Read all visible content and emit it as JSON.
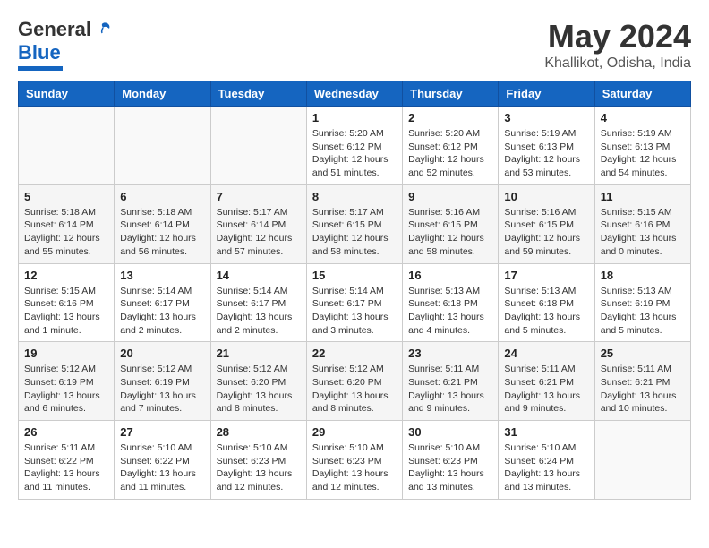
{
  "header": {
    "logo_general": "General",
    "logo_blue": "Blue",
    "month": "May 2024",
    "location": "Khallikot, Odisha, India"
  },
  "weekdays": [
    "Sunday",
    "Monday",
    "Tuesday",
    "Wednesday",
    "Thursday",
    "Friday",
    "Saturday"
  ],
  "weeks": [
    [
      {
        "day": "",
        "sunrise": "",
        "sunset": "",
        "daylight": ""
      },
      {
        "day": "",
        "sunrise": "",
        "sunset": "",
        "daylight": ""
      },
      {
        "day": "",
        "sunrise": "",
        "sunset": "",
        "daylight": ""
      },
      {
        "day": "1",
        "sunrise": "Sunrise: 5:20 AM",
        "sunset": "Sunset: 6:12 PM",
        "daylight": "Daylight: 12 hours and 51 minutes."
      },
      {
        "day": "2",
        "sunrise": "Sunrise: 5:20 AM",
        "sunset": "Sunset: 6:12 PM",
        "daylight": "Daylight: 12 hours and 52 minutes."
      },
      {
        "day": "3",
        "sunrise": "Sunrise: 5:19 AM",
        "sunset": "Sunset: 6:13 PM",
        "daylight": "Daylight: 12 hours and 53 minutes."
      },
      {
        "day": "4",
        "sunrise": "Sunrise: 5:19 AM",
        "sunset": "Sunset: 6:13 PM",
        "daylight": "Daylight: 12 hours and 54 minutes."
      }
    ],
    [
      {
        "day": "5",
        "sunrise": "Sunrise: 5:18 AM",
        "sunset": "Sunset: 6:14 PM",
        "daylight": "Daylight: 12 hours and 55 minutes."
      },
      {
        "day": "6",
        "sunrise": "Sunrise: 5:18 AM",
        "sunset": "Sunset: 6:14 PM",
        "daylight": "Daylight: 12 hours and 56 minutes."
      },
      {
        "day": "7",
        "sunrise": "Sunrise: 5:17 AM",
        "sunset": "Sunset: 6:14 PM",
        "daylight": "Daylight: 12 hours and 57 minutes."
      },
      {
        "day": "8",
        "sunrise": "Sunrise: 5:17 AM",
        "sunset": "Sunset: 6:15 PM",
        "daylight": "Daylight: 12 hours and 58 minutes."
      },
      {
        "day": "9",
        "sunrise": "Sunrise: 5:16 AM",
        "sunset": "Sunset: 6:15 PM",
        "daylight": "Daylight: 12 hours and 58 minutes."
      },
      {
        "day": "10",
        "sunrise": "Sunrise: 5:16 AM",
        "sunset": "Sunset: 6:15 PM",
        "daylight": "Daylight: 12 hours and 59 minutes."
      },
      {
        "day": "11",
        "sunrise": "Sunrise: 5:15 AM",
        "sunset": "Sunset: 6:16 PM",
        "daylight": "Daylight: 13 hours and 0 minutes."
      }
    ],
    [
      {
        "day": "12",
        "sunrise": "Sunrise: 5:15 AM",
        "sunset": "Sunset: 6:16 PM",
        "daylight": "Daylight: 13 hours and 1 minute."
      },
      {
        "day": "13",
        "sunrise": "Sunrise: 5:14 AM",
        "sunset": "Sunset: 6:17 PM",
        "daylight": "Daylight: 13 hours and 2 minutes."
      },
      {
        "day": "14",
        "sunrise": "Sunrise: 5:14 AM",
        "sunset": "Sunset: 6:17 PM",
        "daylight": "Daylight: 13 hours and 2 minutes."
      },
      {
        "day": "15",
        "sunrise": "Sunrise: 5:14 AM",
        "sunset": "Sunset: 6:17 PM",
        "daylight": "Daylight: 13 hours and 3 minutes."
      },
      {
        "day": "16",
        "sunrise": "Sunrise: 5:13 AM",
        "sunset": "Sunset: 6:18 PM",
        "daylight": "Daylight: 13 hours and 4 minutes."
      },
      {
        "day": "17",
        "sunrise": "Sunrise: 5:13 AM",
        "sunset": "Sunset: 6:18 PM",
        "daylight": "Daylight: 13 hours and 5 minutes."
      },
      {
        "day": "18",
        "sunrise": "Sunrise: 5:13 AM",
        "sunset": "Sunset: 6:19 PM",
        "daylight": "Daylight: 13 hours and 5 minutes."
      }
    ],
    [
      {
        "day": "19",
        "sunrise": "Sunrise: 5:12 AM",
        "sunset": "Sunset: 6:19 PM",
        "daylight": "Daylight: 13 hours and 6 minutes."
      },
      {
        "day": "20",
        "sunrise": "Sunrise: 5:12 AM",
        "sunset": "Sunset: 6:19 PM",
        "daylight": "Daylight: 13 hours and 7 minutes."
      },
      {
        "day": "21",
        "sunrise": "Sunrise: 5:12 AM",
        "sunset": "Sunset: 6:20 PM",
        "daylight": "Daylight: 13 hours and 8 minutes."
      },
      {
        "day": "22",
        "sunrise": "Sunrise: 5:12 AM",
        "sunset": "Sunset: 6:20 PM",
        "daylight": "Daylight: 13 hours and 8 minutes."
      },
      {
        "day": "23",
        "sunrise": "Sunrise: 5:11 AM",
        "sunset": "Sunset: 6:21 PM",
        "daylight": "Daylight: 13 hours and 9 minutes."
      },
      {
        "day": "24",
        "sunrise": "Sunrise: 5:11 AM",
        "sunset": "Sunset: 6:21 PM",
        "daylight": "Daylight: 13 hours and 9 minutes."
      },
      {
        "day": "25",
        "sunrise": "Sunrise: 5:11 AM",
        "sunset": "Sunset: 6:21 PM",
        "daylight": "Daylight: 13 hours and 10 minutes."
      }
    ],
    [
      {
        "day": "26",
        "sunrise": "Sunrise: 5:11 AM",
        "sunset": "Sunset: 6:22 PM",
        "daylight": "Daylight: 13 hours and 11 minutes."
      },
      {
        "day": "27",
        "sunrise": "Sunrise: 5:10 AM",
        "sunset": "Sunset: 6:22 PM",
        "daylight": "Daylight: 13 hours and 11 minutes."
      },
      {
        "day": "28",
        "sunrise": "Sunrise: 5:10 AM",
        "sunset": "Sunset: 6:23 PM",
        "daylight": "Daylight: 13 hours and 12 minutes."
      },
      {
        "day": "29",
        "sunrise": "Sunrise: 5:10 AM",
        "sunset": "Sunset: 6:23 PM",
        "daylight": "Daylight: 13 hours and 12 minutes."
      },
      {
        "day": "30",
        "sunrise": "Sunrise: 5:10 AM",
        "sunset": "Sunset: 6:23 PM",
        "daylight": "Daylight: 13 hours and 13 minutes."
      },
      {
        "day": "31",
        "sunrise": "Sunrise: 5:10 AM",
        "sunset": "Sunset: 6:24 PM",
        "daylight": "Daylight: 13 hours and 13 minutes."
      },
      {
        "day": "",
        "sunrise": "",
        "sunset": "",
        "daylight": ""
      }
    ]
  ]
}
